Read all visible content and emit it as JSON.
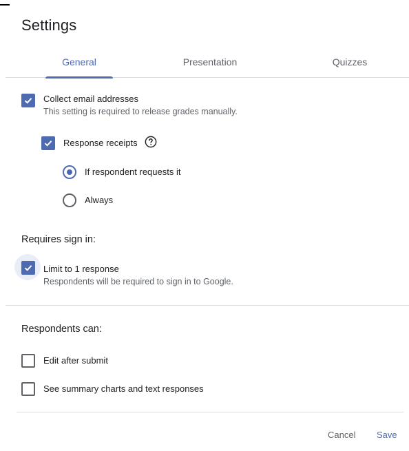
{
  "dialog": {
    "title": "Settings"
  },
  "tabs": [
    {
      "label": "General",
      "active": true
    },
    {
      "label": "Presentation",
      "active": false
    },
    {
      "label": "Quizzes",
      "active": false
    }
  ],
  "general": {
    "collect_email": {
      "label": "Collect email addresses",
      "description": "This setting is required to release grades manually.",
      "checked": true
    },
    "response_receipts": {
      "label": "Response receipts",
      "checked": true,
      "help_icon": "help-circle-icon",
      "options": [
        {
          "label": "If respondent requests it",
          "selected": true
        },
        {
          "label": "Always",
          "selected": false
        }
      ]
    },
    "requires_sign_in": {
      "heading": "Requires sign in:",
      "limit_one": {
        "label": "Limit to 1 response",
        "description": "Respondents will be required to sign in to Google.",
        "checked": true
      }
    },
    "respondents_can": {
      "heading": "Respondents can:",
      "edit_after_submit": {
        "label": "Edit after submit",
        "checked": false
      },
      "see_summary": {
        "label": "See summary charts and text responses",
        "checked": false
      }
    }
  },
  "footer": {
    "cancel_label": "Cancel",
    "save_label": "Save"
  },
  "colors": {
    "accent": "#4e6bb1",
    "text": "#202124",
    "secondary_text": "#5f6368",
    "divider": "#dadce0"
  }
}
